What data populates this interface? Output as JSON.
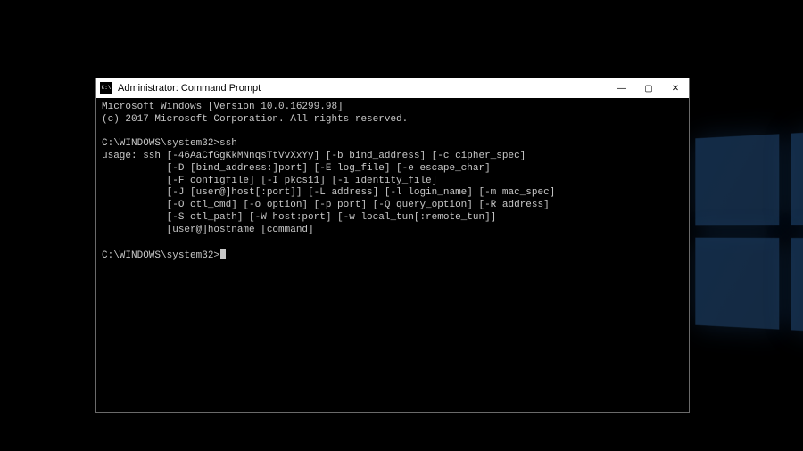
{
  "window": {
    "title": "Administrator: Command Prompt",
    "icon": "cmd-icon",
    "buttons": {
      "minimize": "—",
      "maximize": "▢",
      "close": "✕"
    }
  },
  "terminal": {
    "banner_line1": "Microsoft Windows [Version 10.0.16299.98]",
    "banner_line2": "(c) 2017 Microsoft Corporation. All rights reserved.",
    "prompt1": "C:\\WINDOWS\\system32>",
    "command1": "ssh",
    "usage_lines": [
      "usage: ssh [-46AaCfGgKkMNnqsTtVvXxYy] [-b bind_address] [-c cipher_spec]",
      "           [-D [bind_address:]port] [-E log_file] [-e escape_char]",
      "           [-F configfile] [-I pkcs11] [-i identity_file]",
      "           [-J [user@]host[:port]] [-L address] [-l login_name] [-m mac_spec]",
      "           [-O ctl_cmd] [-o option] [-p port] [-Q query_option] [-R address]",
      "           [-S ctl_path] [-W host:port] [-w local_tun[:remote_tun]]",
      "           [user@]hostname [command]"
    ],
    "prompt2": "C:\\WINDOWS\\system32>"
  }
}
